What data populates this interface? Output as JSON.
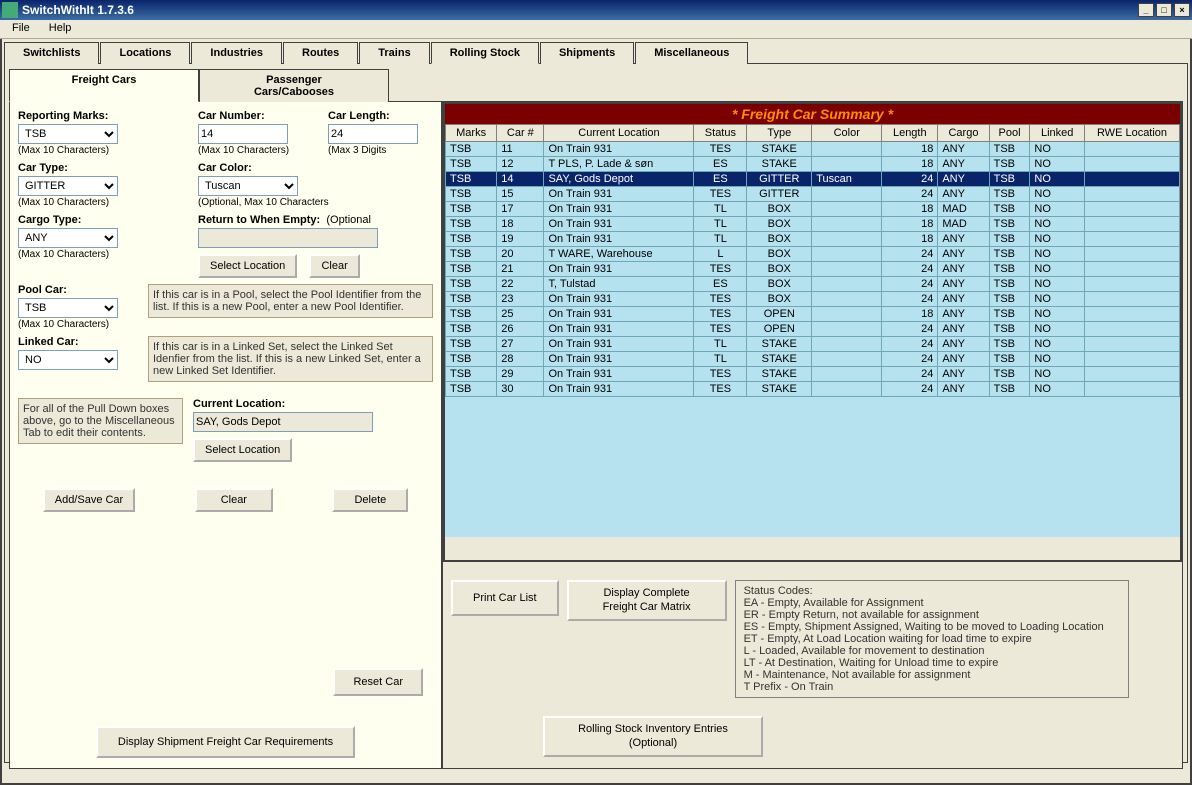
{
  "window": {
    "title": "SwitchWithIt 1.7.3.6",
    "min": "_",
    "max": "□",
    "close": "×"
  },
  "menus": {
    "file": "File",
    "help": "Help"
  },
  "tabs": {
    "switchlists": "Switchlists",
    "locations": "Locations",
    "industries": "Industries",
    "routes": "Routes",
    "trains": "Trains",
    "rolling_stock": "Rolling Stock",
    "shipments": "Shipments",
    "misc": "Miscellaneous"
  },
  "subtabs": {
    "freight": "Freight Cars",
    "passenger": "Passenger Cars/Cabooses"
  },
  "form": {
    "reporting_marks": {
      "label": "Reporting Marks:",
      "value": "TSB",
      "hint": "(Max 10 Characters)"
    },
    "car_number": {
      "label": "Car Number:",
      "value": "14",
      "hint": "(Max 10 Characters)"
    },
    "car_length": {
      "label": "Car Length:",
      "value": "24",
      "hint": "(Max 3 Digits"
    },
    "car_type": {
      "label": "Car Type:",
      "value": "GITTER",
      "hint": "(Max 10 Characters)"
    },
    "car_color": {
      "label": "Car Color:",
      "value": "Tuscan",
      "hint": "(Optional, Max 10 Characters"
    },
    "cargo_type": {
      "label": "Cargo Type:",
      "value": "ANY",
      "hint": "(Max 10 Characters)"
    },
    "return_empty": {
      "label": "Return to When Empty:",
      "hint": "(Optional",
      "value": ""
    },
    "pool_car": {
      "label": "Pool Car:",
      "value": "TSB",
      "hint": "(Max 10 Characters)",
      "help": "If this car is in a Pool, select the Pool Identifier from the list.  If this is a new Pool, enter a new Pool Identifier."
    },
    "linked_car": {
      "label": "Linked Car:",
      "value": "NO",
      "help": "If this car is in a Linked Set, select the Linked Set Idenfier from the list.  If this is a new Linked Set, enter a new Linked Set Identifier."
    },
    "pulldown_note": "For all of the Pull Down boxes above, go to the Miscellaneous Tab to edit their contents.",
    "current_location": {
      "label": "Current Location:",
      "value": "SAY, Gods Depot"
    }
  },
  "buttons": {
    "select_location": "Select Location",
    "clear": "Clear",
    "add_save": "Add/Save Car",
    "delete": "Delete",
    "reset_car": "Reset Car",
    "print_list": "Print Car List",
    "display_matrix": "Display Complete Freight Car Matrix",
    "display_req": "Display Shipment Freight Car Requirements",
    "rolling_inv": "Rolling Stock Inventory Entries (Optional)"
  },
  "summary": {
    "title": "* Freight Car Summary *",
    "headers": {
      "marks": "Marks",
      "car_no": "Car #",
      "location": "Current Location",
      "status": "Status",
      "type": "Type",
      "color": "Color",
      "length": "Length",
      "cargo": "Cargo",
      "pool": "Pool",
      "linked": "Linked",
      "rwe": "RWE Location"
    },
    "rows": [
      {
        "marks": "TSB",
        "no": "11",
        "loc": "On Train 931",
        "status": "TES",
        "type": "STAKE",
        "color": "",
        "len": "18",
        "cargo": "ANY",
        "pool": "TSB",
        "linked": "NO",
        "rwe": ""
      },
      {
        "marks": "TSB",
        "no": "12",
        "loc": "T PLS, P. Lade & søn",
        "status": "ES",
        "type": "STAKE",
        "color": "",
        "len": "18",
        "cargo": "ANY",
        "pool": "TSB",
        "linked": "NO",
        "rwe": ""
      },
      {
        "marks": "TSB",
        "no": "14",
        "loc": "SAY, Gods Depot",
        "status": "ES",
        "type": "GITTER",
        "color": "Tuscan",
        "len": "24",
        "cargo": "ANY",
        "pool": "TSB",
        "linked": "NO",
        "rwe": "",
        "selected": true
      },
      {
        "marks": "TSB",
        "no": "15",
        "loc": "On Train 931",
        "status": "TES",
        "type": "GITTER",
        "color": "",
        "len": "24",
        "cargo": "ANY",
        "pool": "TSB",
        "linked": "NO",
        "rwe": ""
      },
      {
        "marks": "TSB",
        "no": "17",
        "loc": "On Train 931",
        "status": "TL",
        "type": "BOX",
        "color": "",
        "len": "18",
        "cargo": "MAD",
        "pool": "TSB",
        "linked": "NO",
        "rwe": ""
      },
      {
        "marks": "TSB",
        "no": "18",
        "loc": "On Train 931",
        "status": "TL",
        "type": "BOX",
        "color": "",
        "len": "18",
        "cargo": "MAD",
        "pool": "TSB",
        "linked": "NO",
        "rwe": ""
      },
      {
        "marks": "TSB",
        "no": "19",
        "loc": "On Train 931",
        "status": "TL",
        "type": "BOX",
        "color": "",
        "len": "18",
        "cargo": "ANY",
        "pool": "TSB",
        "linked": "NO",
        "rwe": ""
      },
      {
        "marks": "TSB",
        "no": "20",
        "loc": "T WARE, Warehouse",
        "status": "L",
        "type": "BOX",
        "color": "",
        "len": "24",
        "cargo": "ANY",
        "pool": "TSB",
        "linked": "NO",
        "rwe": ""
      },
      {
        "marks": "TSB",
        "no": "21",
        "loc": "On Train 931",
        "status": "TES",
        "type": "BOX",
        "color": "",
        "len": "24",
        "cargo": "ANY",
        "pool": "TSB",
        "linked": "NO",
        "rwe": ""
      },
      {
        "marks": "TSB",
        "no": "22",
        "loc": "T, Tulstad",
        "status": "ES",
        "type": "BOX",
        "color": "",
        "len": "24",
        "cargo": "ANY",
        "pool": "TSB",
        "linked": "NO",
        "rwe": ""
      },
      {
        "marks": "TSB",
        "no": "23",
        "loc": "On Train 931",
        "status": "TES",
        "type": "BOX",
        "color": "",
        "len": "24",
        "cargo": "ANY",
        "pool": "TSB",
        "linked": "NO",
        "rwe": ""
      },
      {
        "marks": "TSB",
        "no": "25",
        "loc": "On Train 931",
        "status": "TES",
        "type": "OPEN",
        "color": "",
        "len": "18",
        "cargo": "ANY",
        "pool": "TSB",
        "linked": "NO",
        "rwe": ""
      },
      {
        "marks": "TSB",
        "no": "26",
        "loc": "On Train 931",
        "status": "TES",
        "type": "OPEN",
        "color": "",
        "len": "24",
        "cargo": "ANY",
        "pool": "TSB",
        "linked": "NO",
        "rwe": ""
      },
      {
        "marks": "TSB",
        "no": "27",
        "loc": "On Train 931",
        "status": "TL",
        "type": "STAKE",
        "color": "",
        "len": "24",
        "cargo": "ANY",
        "pool": "TSB",
        "linked": "NO",
        "rwe": ""
      },
      {
        "marks": "TSB",
        "no": "28",
        "loc": "On Train 931",
        "status": "TL",
        "type": "STAKE",
        "color": "",
        "len": "24",
        "cargo": "ANY",
        "pool": "TSB",
        "linked": "NO",
        "rwe": ""
      },
      {
        "marks": "TSB",
        "no": "29",
        "loc": "On Train 931",
        "status": "TES",
        "type": "STAKE",
        "color": "",
        "len": "24",
        "cargo": "ANY",
        "pool": "TSB",
        "linked": "NO",
        "rwe": ""
      },
      {
        "marks": "TSB",
        "no": "30",
        "loc": "On Train 931",
        "status": "TES",
        "type": "STAKE",
        "color": "",
        "len": "24",
        "cargo": "ANY",
        "pool": "TSB",
        "linked": "NO",
        "rwe": ""
      }
    ]
  },
  "status_codes": {
    "title": "Status Codes:",
    "lines": [
      "EA - Empty, Available for Assignment",
      "ER - Empty Return, not available for assignment",
      "ES - Empty, Shipment Assigned, Waiting to be moved to Loading Location",
      "ET - Empty, At Load Location waiting for load time to expire",
      "L - Loaded, Available for movement to destination",
      "LT - At Destination, Waiting for Unload time to expire",
      "M - Maintenance, Not available for assignment",
      "T Prefix - On Train"
    ]
  }
}
